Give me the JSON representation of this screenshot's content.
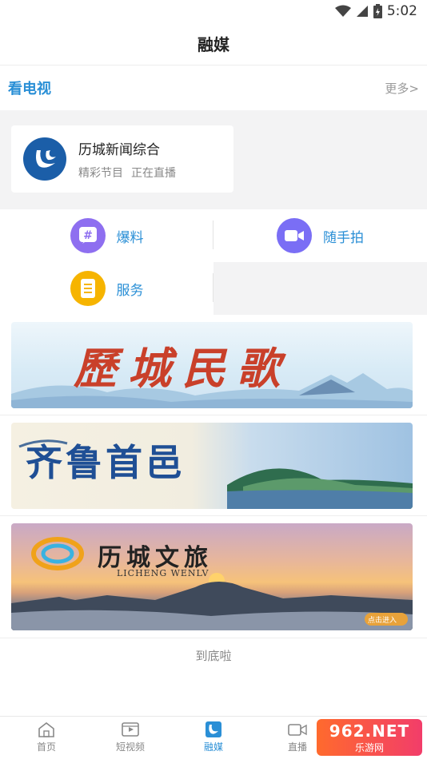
{
  "status_bar": {
    "time": "5:02"
  },
  "header": {
    "title": "融媒"
  },
  "tv_section": {
    "title": "看电视",
    "more": "更多>"
  },
  "live_channel": {
    "name": "历城新闻综合",
    "subtitle_1": "精彩节目",
    "subtitle_2": "正在直播"
  },
  "actions": [
    {
      "label": "爆料",
      "icon": "hashtag-chat-icon",
      "color": "#8e6ff0"
    },
    {
      "label": "随手拍",
      "icon": "video-camera-icon",
      "color": "#7a6ef5"
    },
    {
      "label": "服务",
      "icon": "document-list-icon",
      "color": "#f6b400"
    }
  ],
  "banners": [
    {
      "title": "歷城民歌",
      "icon": "banner-ink-mountain"
    },
    {
      "title": "齐鲁首邑",
      "icon": "banner-lake-island"
    },
    {
      "title": "历城文旅",
      "subtitle": "LICHENG WENLV",
      "badge": "点击进入",
      "icon": "banner-sunset-hill"
    }
  ],
  "footer": {
    "end_text": "到底啦"
  },
  "bottom_nav": [
    {
      "label": "首页",
      "icon": "home-icon"
    },
    {
      "label": "短视频",
      "icon": "film-icon"
    },
    {
      "label": "融媒",
      "icon": "rongmei-logo-icon",
      "active": true
    },
    {
      "label": "直播",
      "icon": "live-camera-icon"
    }
  ],
  "watermark": {
    "text": "962.NET",
    "sub": "乐游网"
  },
  "colors": {
    "accent": "#2a8fd6",
    "brand_blue": "#1b5ea8",
    "page_gray": "#f3f3f4"
  }
}
